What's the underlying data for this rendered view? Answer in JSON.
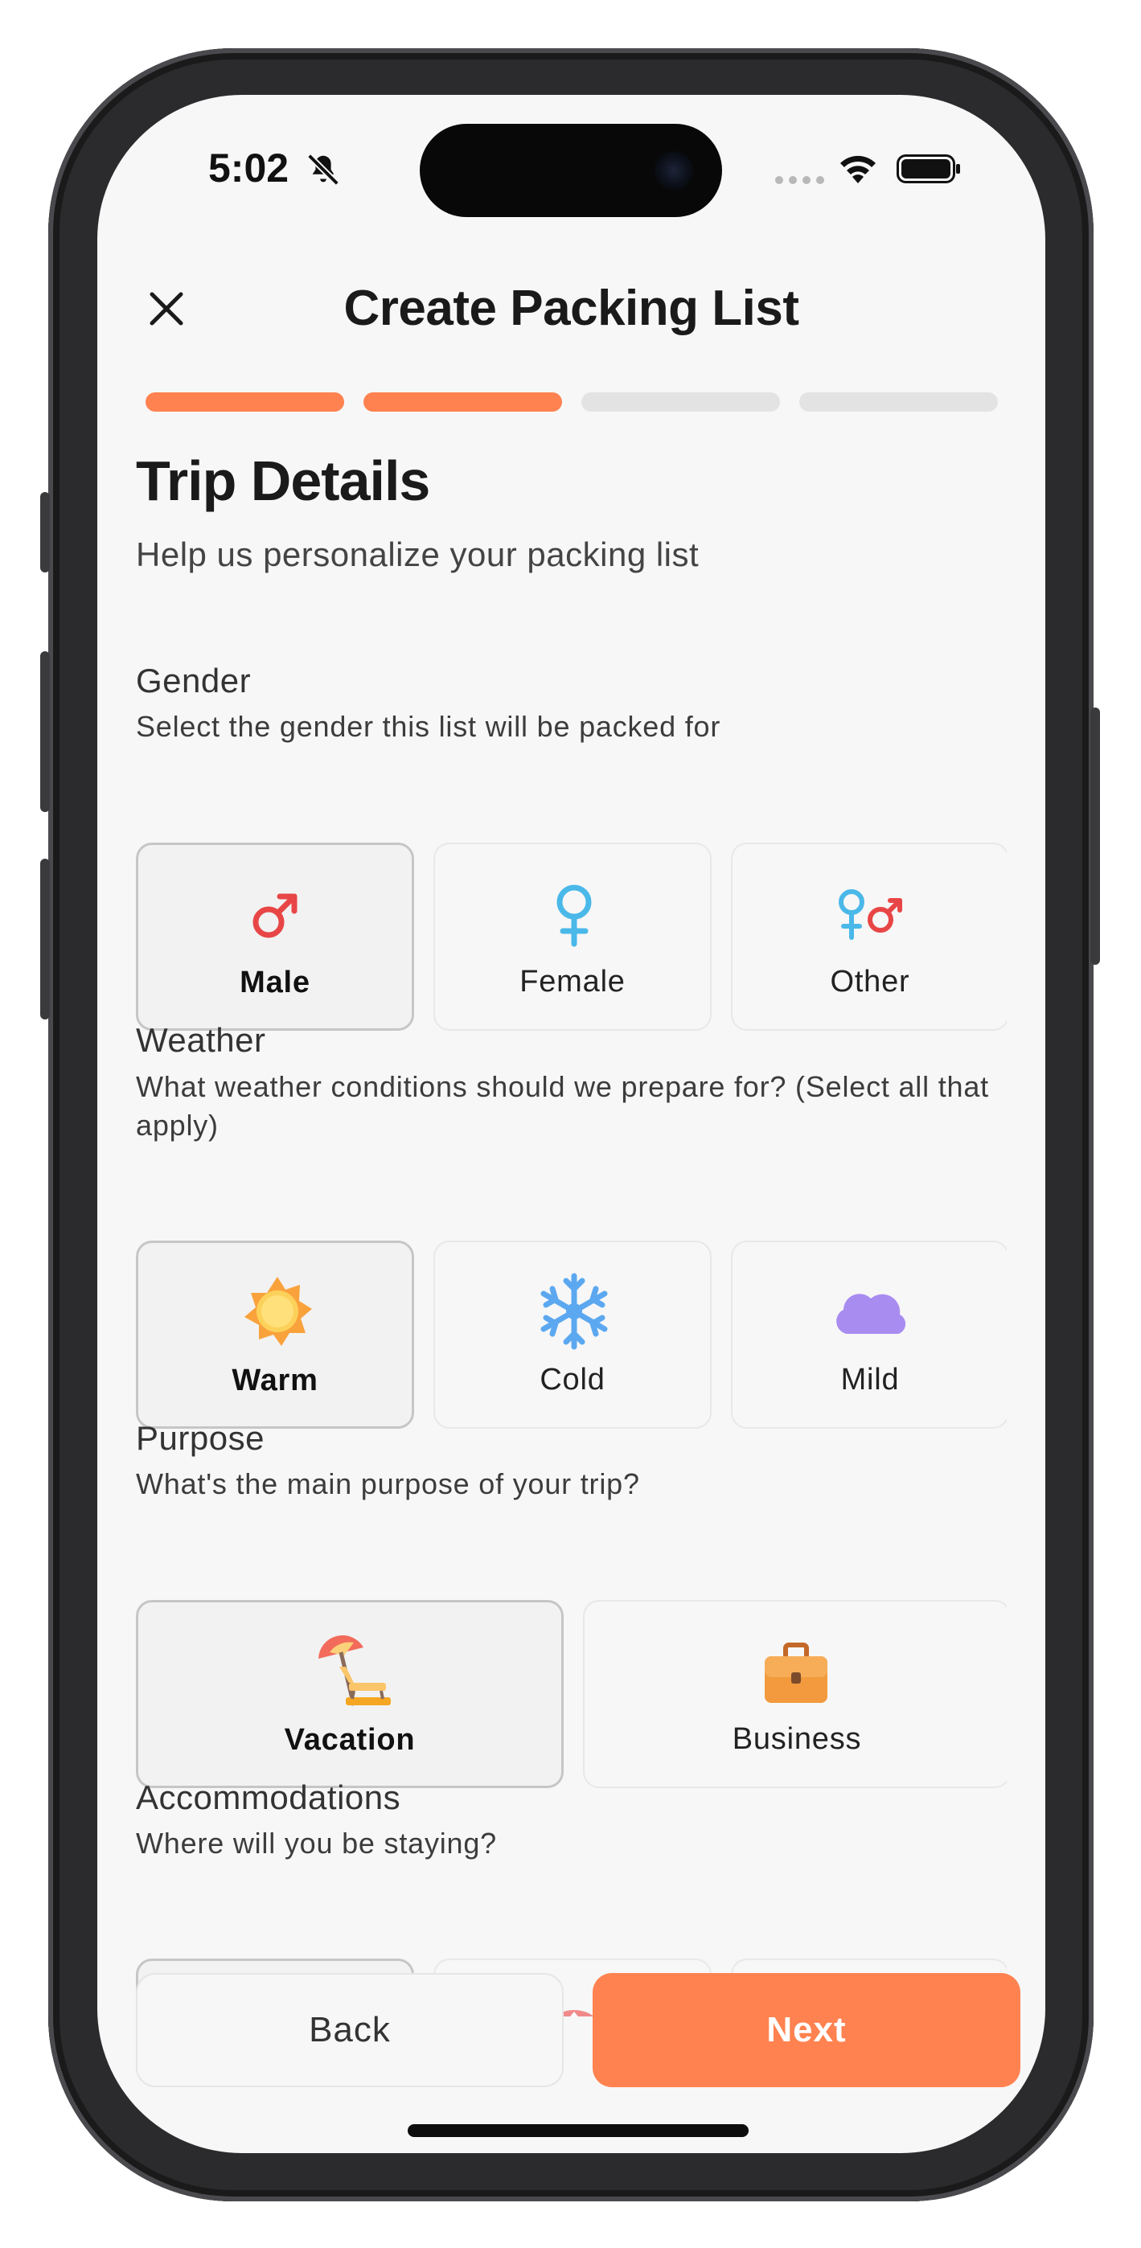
{
  "status_bar": {
    "time": "5:02",
    "icons": [
      "bell-slash-icon",
      "signal-dots-icon",
      "wifi-icon",
      "battery-icon"
    ]
  },
  "header": {
    "title": "Create Packing List",
    "close_icon": "close-icon"
  },
  "progress": {
    "steps_total": 4,
    "steps_done": 2,
    "accent": "#ff8250",
    "inactive": "#e3e3e3"
  },
  "main": {
    "title": "Trip Details",
    "subtitle": "Help us personalize your packing list",
    "sections": {
      "gender": {
        "title": "Gender",
        "description": "Select the gender this list will be packed for",
        "options": [
          {
            "label": "Male",
            "icon": "male-symbol-icon",
            "selected": true
          },
          {
            "label": "Female",
            "icon": "female-symbol-icon",
            "selected": false
          },
          {
            "label": "Other",
            "icon": "other-gender-icon",
            "selected": false
          }
        ]
      },
      "weather": {
        "title": "Weather",
        "description": "What weather conditions should we prepare for? (Select all that apply)",
        "options": [
          {
            "label": "Warm",
            "icon": "sun-icon",
            "selected": true
          },
          {
            "label": "Cold",
            "icon": "snowflake-icon",
            "selected": false
          },
          {
            "label": "Mild",
            "icon": "cloud-icon",
            "selected": false
          }
        ]
      },
      "purpose": {
        "title": "Purpose",
        "description": "What's the main purpose of your trip?",
        "options": [
          {
            "label": "Vacation",
            "icon": "beach-umbrella-icon",
            "selected": true
          },
          {
            "label": "Business",
            "icon": "briefcase-icon",
            "selected": false
          }
        ]
      },
      "accommodations": {
        "title": "Accommodations",
        "description": "Where will you be staying?",
        "options": [
          {
            "icon": "hotel-icon",
            "selected": true
          },
          {
            "icon": "tent-icon",
            "selected": false
          },
          {
            "icon": "house-icon",
            "selected": false
          }
        ]
      }
    }
  },
  "footer": {
    "back_label": "Back",
    "next_label": "Next"
  },
  "colors": {
    "accent": "#ff8250",
    "male": "#e84646",
    "female": "#4ab8e8",
    "sun": "#f9b84a",
    "snow": "#5ca8f0",
    "cloud": "#a98cf0"
  }
}
